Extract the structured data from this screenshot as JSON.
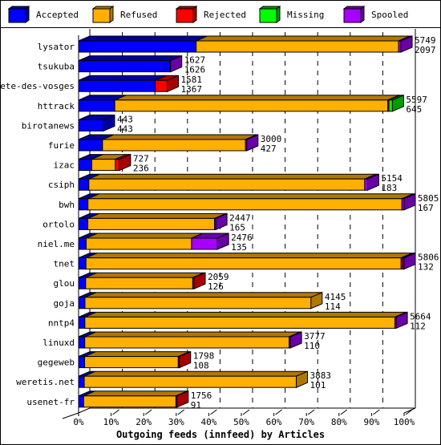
{
  "chart_data": {
    "type": "bar",
    "orientation": "horizontal",
    "stacked": true,
    "style": "3d",
    "title": "",
    "xlabel": "Outgoing feeds (innfeed) by Articles",
    "ylabel": "",
    "xlim": [
      0,
      100
    ],
    "x_unit": "%",
    "x_ticks": [
      "0%",
      "10%",
      "20%",
      "30%",
      "40%",
      "50%",
      "60%",
      "70%",
      "80%",
      "90%",
      "100%"
    ],
    "grid": "dashed vertical",
    "legend_position": "top",
    "legend": [
      {
        "name": "Accepted",
        "color": "#0000ff",
        "side": "#00009c"
      },
      {
        "name": "Refused",
        "color": "#ffb000",
        "side": "#b07800"
      },
      {
        "name": "Rejected",
        "color": "#ff0000",
        "side": "#a80000"
      },
      {
        "name": "Missing",
        "color": "#00ff00",
        "side": "#009c00"
      },
      {
        "name": "Spooled",
        "color": "#a800ff",
        "side": "#6a00a8"
      }
    ],
    "max_total": 5806,
    "categories": [
      "lysator",
      "tsukuba",
      "bete-des-vosges",
      "httrack",
      "birotanews",
      "furie",
      "izac",
      "csiph",
      "bwh",
      "ortolo",
      "niel.me",
      "tnet",
      "glou",
      "goja",
      "nntp4",
      "linuxd",
      "gegeweb",
      "weretis.net",
      "usenet-fr"
    ],
    "totals": [
      5749,
      1627,
      1581,
      5597,
      443,
      3000,
      727,
      5154,
      5805,
      2447,
      2476,
      5806,
      2059,
      4145,
      5664,
      3777,
      1798,
      3883,
      1756
    ],
    "accepted_labels": [
      2097,
      1626,
      1367,
      645,
      443,
      427,
      236,
      183,
      167,
      165,
      135,
      132,
      126,
      114,
      112,
      110,
      108,
      101,
      91
    ],
    "series": [
      {
        "name": "Accepted",
        "values": [
          2097,
          1626,
          1367,
          645,
          443,
          427,
          236,
          183,
          167,
          165,
          135,
          132,
          126,
          114,
          112,
          110,
          108,
          101,
          91
        ]
      },
      {
        "name": "Refused",
        "values": [
          3610,
          0,
          0,
          4870,
          0,
          2550,
          420,
          4920,
          5600,
          2260,
          1880,
          5620,
          1910,
          4031,
          5530,
          3645,
          1670,
          3782,
          1645
        ]
      },
      {
        "name": "Rejected",
        "values": [
          0,
          0,
          214,
          20,
          0,
          0,
          71,
          0,
          0,
          0,
          0,
          30,
          23,
          0,
          0,
          0,
          20,
          0,
          20
        ]
      },
      {
        "name": "Missing",
        "values": [
          0,
          0,
          0,
          62,
          0,
          0,
          0,
          0,
          0,
          0,
          0,
          0,
          0,
          0,
          0,
          0,
          0,
          0,
          0
        ]
      },
      {
        "name": "Spooled",
        "values": [
          42,
          1,
          0,
          0,
          0,
          23,
          0,
          51,
          38,
          22,
          461,
          24,
          0,
          0,
          22,
          22,
          0,
          0,
          0
        ]
      }
    ]
  }
}
